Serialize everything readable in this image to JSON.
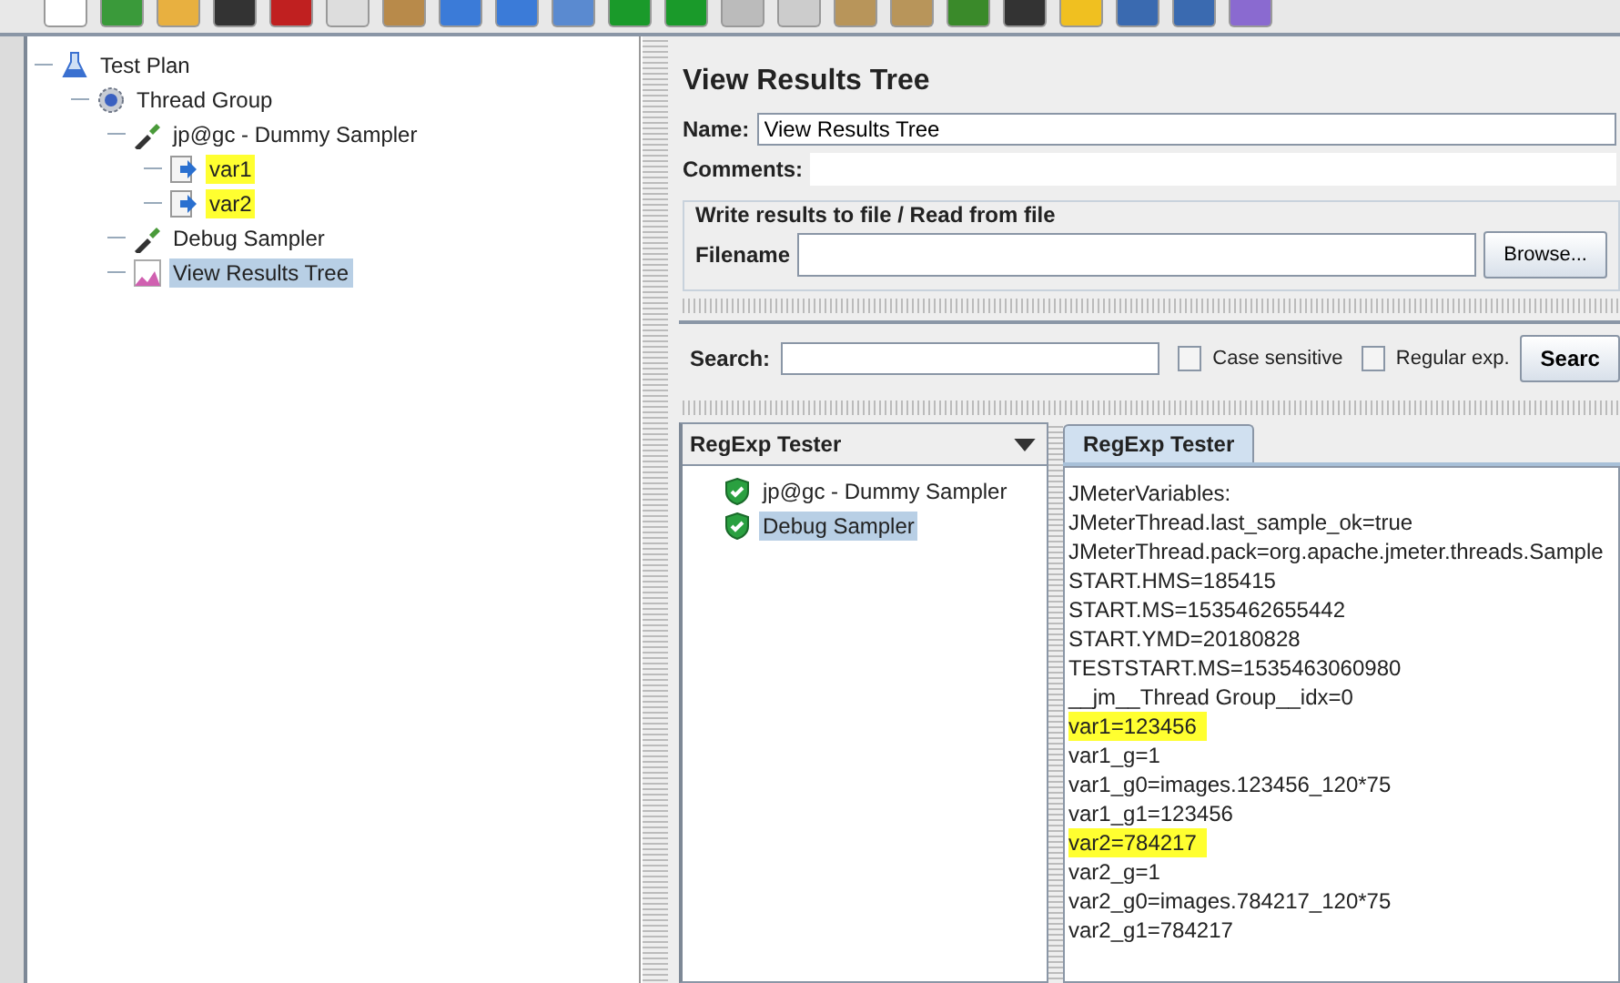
{
  "tree": [
    {
      "label": "Test Plan",
      "kind": "plan",
      "selected": false,
      "highlighted": false,
      "children": [
        {
          "label": "Thread Group",
          "kind": "group",
          "selected": false,
          "highlighted": false,
          "children": [
            {
              "label": "jp@gc - Dummy Sampler",
              "kind": "sampler",
              "selected": false,
              "highlighted": false,
              "children": [
                {
                  "label": "var1",
                  "kind": "extractor",
                  "selected": false,
                  "highlighted": true
                },
                {
                  "label": "var2",
                  "kind": "extractor",
                  "selected": false,
                  "highlighted": true
                }
              ]
            },
            {
              "label": "Debug Sampler",
              "kind": "sampler",
              "selected": false,
              "highlighted": false
            },
            {
              "label": "View Results Tree",
              "kind": "listener",
              "selected": true,
              "highlighted": false
            }
          ]
        }
      ]
    }
  ],
  "editor": {
    "title": "View Results Tree",
    "name_label": "Name:",
    "name_value": "View Results Tree",
    "comments_label": "Comments:",
    "file_group": {
      "legend": "Write results to file / Read from file",
      "filename_label": "Filename",
      "browse_button": "Browse..."
    },
    "search": {
      "label": "Search:",
      "options": [
        {
          "label": "Case sensitive",
          "checked": false
        },
        {
          "label": "Regular exp.",
          "checked": false
        }
      ],
      "button": "Searc"
    },
    "renderer": "RegExp Tester",
    "results": [
      {
        "label": "jp@gc - Dummy Sampler",
        "selected": false
      },
      {
        "label": "Debug Sampler",
        "selected": true
      }
    ],
    "tabs": [
      {
        "label": "RegExp Tester",
        "selected": true
      }
    ],
    "output_lines": [
      {
        "text": "JMeterVariables:",
        "highlighted": false
      },
      {
        "text": "JMeterThread.last_sample_ok=true",
        "highlighted": false
      },
      {
        "text": "JMeterThread.pack=org.apache.jmeter.threads.Sample",
        "highlighted": false
      },
      {
        "text": "START.HMS=185415",
        "highlighted": false
      },
      {
        "text": "START.MS=1535462655442",
        "highlighted": false
      },
      {
        "text": "START.YMD=20180828",
        "highlighted": false
      },
      {
        "text": "TESTSTART.MS=1535463060980",
        "highlighted": false
      },
      {
        "text": "__jm__Thread Group__idx=0",
        "highlighted": false
      },
      {
        "text": "var1=123456",
        "highlighted": true
      },
      {
        "text": "var1_g=1",
        "highlighted": false
      },
      {
        "text": "var1_g0=images.123456_120*75",
        "highlighted": false
      },
      {
        "text": "var1_g1=123456",
        "highlighted": false
      },
      {
        "text": "var2=784217",
        "highlighted": true
      },
      {
        "text": "var2_g=1",
        "highlighted": false
      },
      {
        "text": "var2_g0=images.784217_120*75",
        "highlighted": false
      },
      {
        "text": "var2_g1=784217",
        "highlighted": false
      }
    ]
  }
}
